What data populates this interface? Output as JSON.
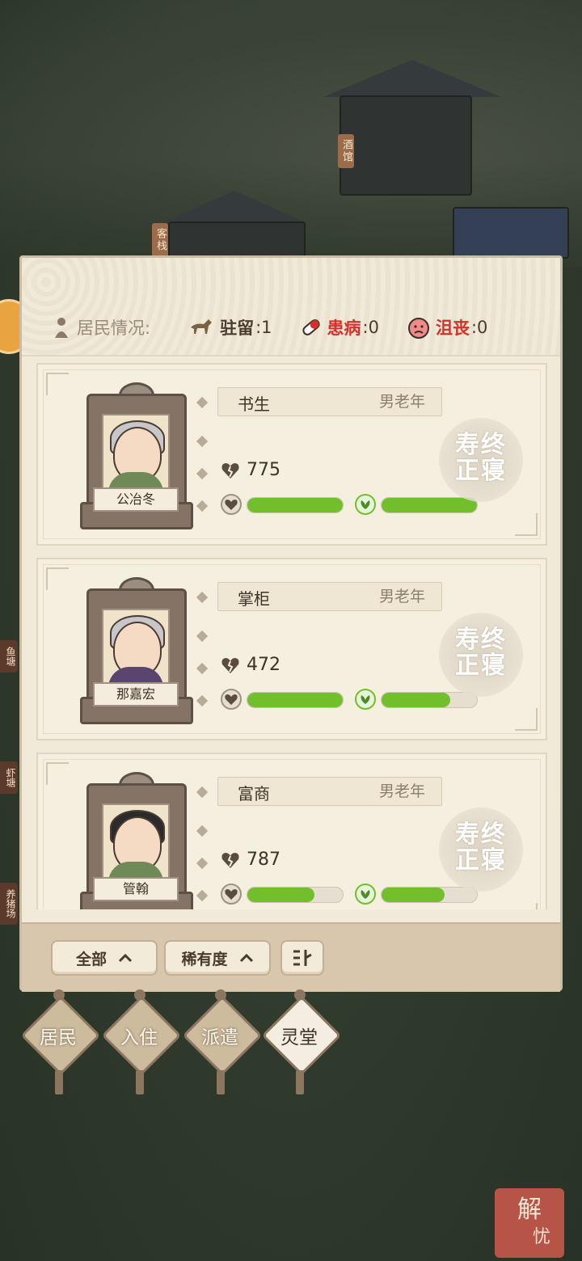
{
  "town_signs": {
    "tavern": "酒馆",
    "inn": "客栈"
  },
  "side_signs": {
    "fish_pond": "鱼塘",
    "shrimp_pond": "虾塘",
    "pig_farm": "养猪场"
  },
  "header": {
    "residents_label": "居民情况:",
    "stationed_label": "驻留",
    "stationed_value": ":1",
    "sick_label": "患病",
    "sick_value": ":0",
    "depressed_label": "沮丧",
    "depressed_value": ":0"
  },
  "cards": [
    {
      "name": "公冶冬",
      "role": "书生",
      "tag": "男老年",
      "value": "775",
      "bar1": 1.0,
      "bar2": 1.0,
      "stamp": "寿终正寝",
      "robe_color": "#6f8a57",
      "hat_color": "#5a7a3b"
    },
    {
      "name": "那嘉宏",
      "role": "掌柜",
      "tag": "男老年",
      "value": "472",
      "bar1": 1.0,
      "bar2": 0.72,
      "stamp": "寿终正寝",
      "robe_color": "#5a4470",
      "hat_color": "#9a9aa2"
    },
    {
      "name": "管翰",
      "role": "富商",
      "tag": "男老年",
      "value": "787",
      "bar1": 0.7,
      "bar2": 0.66,
      "stamp": "寿终正寝",
      "robe_color": "#6f8a57",
      "hat_color": "#2b2b2b"
    }
  ],
  "footer": {
    "all_label": "全部",
    "rarity_label": "稀有度",
    "sort_icon": "sort-icon"
  },
  "nav": [
    {
      "label": "居民"
    },
    {
      "label": "入住"
    },
    {
      "label": "派遣"
    },
    {
      "label": "灵堂"
    }
  ],
  "corner_seal": {
    "line1": "解",
    "line2": "忧"
  },
  "colors": {
    "accent_green": "#72bf2e",
    "alert_red": "#d2322a",
    "panel_bg": "#f1ead9"
  }
}
